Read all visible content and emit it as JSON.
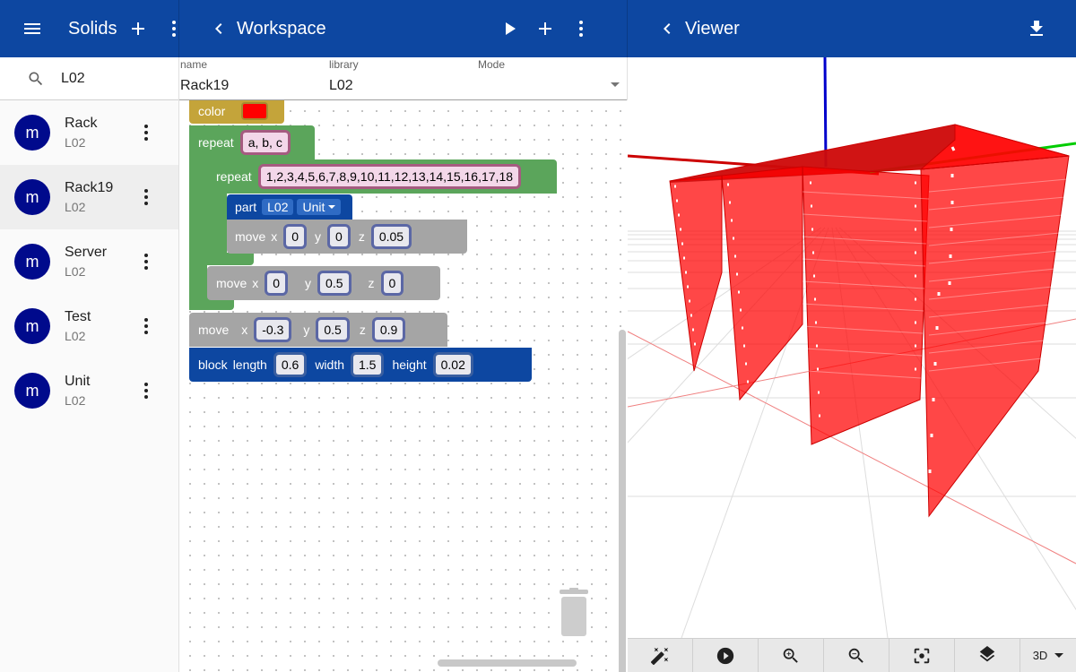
{
  "left_panel": {
    "title": "Solids",
    "search_value": "L02",
    "items": [
      {
        "name": "Rack",
        "library": "L02",
        "avatar": "m"
      },
      {
        "name": "Rack19",
        "library": "L02",
        "avatar": "m"
      },
      {
        "name": "Server",
        "library": "L02",
        "avatar": "m"
      },
      {
        "name": "Test",
        "library": "L02",
        "avatar": "m"
      },
      {
        "name": "Unit",
        "library": "L02",
        "avatar": "m"
      }
    ]
  },
  "workspace": {
    "title": "Workspace",
    "fields": {
      "name_label": "name",
      "name_value": "Rack19",
      "library_label": "library",
      "library_value": "L02",
      "mode_label": "Mode"
    },
    "blocks": {
      "color_label": "color",
      "color_value": "#ff0000",
      "repeat1_label": "repeat",
      "repeat1_value": "a, b, c",
      "repeat2_label": "repeat",
      "repeat2_value": "1,2,3,4,5,6,7,8,9,10,11,12,13,14,15,16,17,18",
      "part_label": "part",
      "part_lib": "L02",
      "part_name": "Unit",
      "move1": {
        "label": "move",
        "x": "0",
        "y": "0",
        "z": "0.05"
      },
      "move2": {
        "label": "move",
        "x": "0",
        "y": "0.5",
        "z": "0"
      },
      "move3": {
        "label": "move",
        "x": "-0.3",
        "y": "0.5",
        "z": "0.9"
      },
      "block": {
        "label": "block",
        "length_label": "length",
        "length": "0.6",
        "width_label": "width",
        "width": "1.5",
        "height_label": "height",
        "height": "0.02"
      },
      "axis_x": "x",
      "axis_y": "y",
      "axis_z": "z"
    }
  },
  "viewer": {
    "title": "Viewer",
    "view_mode": "3D"
  },
  "colors": {
    "appbar": "#0d47a1",
    "avatar": "#000a8c",
    "block_green": "#5ba55b",
    "block_blue": "#0d47a1",
    "block_gray": "#a5a5a5",
    "block_gold": "#c4a43a",
    "solid_red": "#ff0000"
  }
}
